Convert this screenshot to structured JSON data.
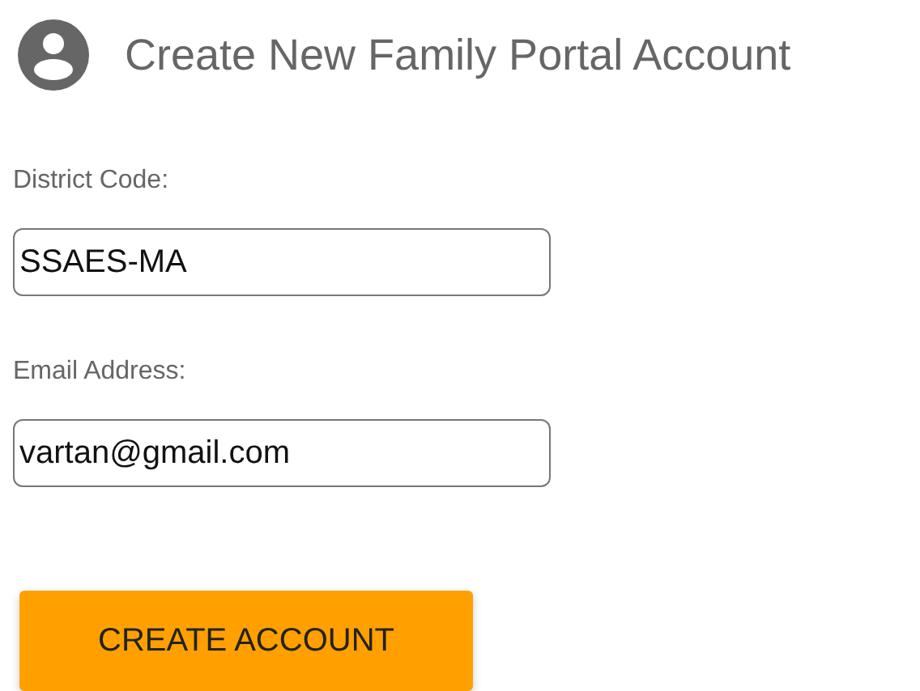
{
  "header": {
    "title": "Create New Family Portal Account"
  },
  "fields": [
    {
      "label": "District Code:",
      "value": "SSAES-MA"
    },
    {
      "label": "Email Address:",
      "value": "vartan@gmail.com"
    }
  ],
  "button": {
    "label": "CREATE ACCOUNT"
  }
}
